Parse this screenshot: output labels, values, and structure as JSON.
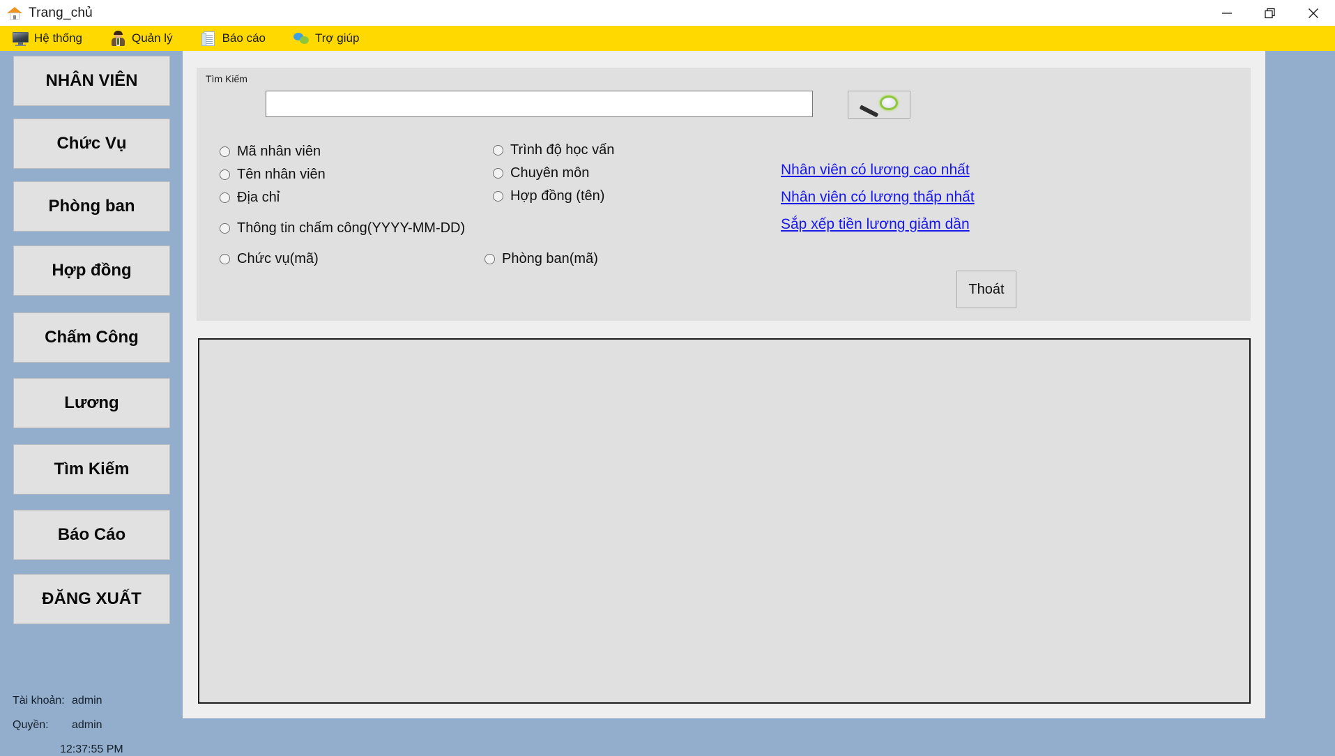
{
  "window": {
    "title": "Trang_chủ",
    "title_icon": "home-icon",
    "controls": {
      "minimize": "minimize-icon",
      "restore": "restore-icon",
      "close": "close-icon"
    },
    "accent_yellow": "#ffd900",
    "desktop_blue": "#93aecd",
    "link_blue": "#1717e8"
  },
  "menubar": {
    "items": [
      {
        "label": "Hệ thống",
        "icon": "monitor-icon"
      },
      {
        "label": "Quản lý",
        "icon": "person-icon"
      },
      {
        "label": "Báo cáo",
        "icon": "document-icon"
      },
      {
        "label": "Trợ giúp",
        "icon": "chat-icon"
      }
    ]
  },
  "sidebar": {
    "items": [
      {
        "label": "NHÂN VIÊN"
      },
      {
        "label": "Chức Vụ"
      },
      {
        "label": "Phòng ban"
      },
      {
        "label": "Hợp đồng"
      },
      {
        "label": "Chấm Công"
      },
      {
        "label": "Lương"
      },
      {
        "label": "Tìm Kiếm"
      },
      {
        "label": "Báo Cáo"
      },
      {
        "label": "ĐĂNG XUẤT"
      }
    ],
    "account": {
      "account_label": "Tài khoản:",
      "account_value": "admin",
      "role_label": "Quyền:",
      "role_value": "admin",
      "time": "12:37:55 PM"
    }
  },
  "search_panel": {
    "group_label": "Tìm Kiếm",
    "input_value": "",
    "input_placeholder": "",
    "search_button_icon": "magnifier-icon",
    "radios": [
      {
        "label": "Mã nhân viên",
        "checked": false
      },
      {
        "label": "Tên nhân viên",
        "checked": false
      },
      {
        "label": "Địa chỉ",
        "checked": false
      },
      {
        "label": "Trình độ học vấn",
        "checked": false
      },
      {
        "label": "Chuyên môn",
        "checked": false
      },
      {
        "label": "Hợp đồng (tên)",
        "checked": false
      },
      {
        "label": "Thông tin chấm công(YYYY-MM-DD)",
        "checked": false
      },
      {
        "label": "Chức vụ(mã)",
        "checked": false
      },
      {
        "label": "Phòng ban(mã)",
        "checked": false
      }
    ],
    "links": [
      {
        "label": "Nhân viên có lương cao nhất"
      },
      {
        "label": "Nhân viên có lương thấp nhất"
      },
      {
        "label": "Sắp xếp tiền lương giảm dần"
      }
    ],
    "exit_button": "Thoát"
  },
  "results": {
    "rows": [],
    "columns": []
  }
}
